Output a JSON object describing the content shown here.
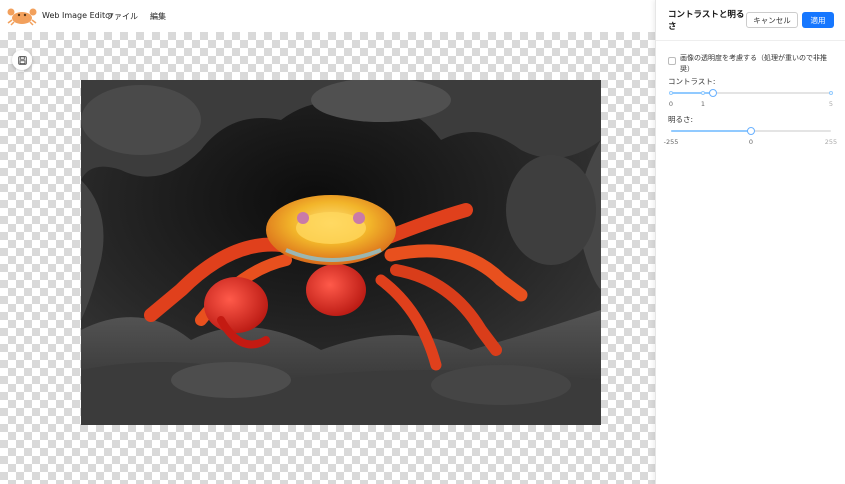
{
  "header": {
    "app_title": "Web Image Editor",
    "menu": {
      "file": "ファイル",
      "edit": "編集"
    }
  },
  "canvas": {
    "save_icon": "save-icon"
  },
  "panel": {
    "title": "コントラストと明るさ",
    "cancel_label": "キャンセル",
    "apply_label": "適用",
    "checkbox_label": "画像の透明度を考慮する（処理が重いので非推奨）",
    "checkbox_checked": false,
    "contrast": {
      "label": "コントラスト:",
      "min": 0,
      "max": 5,
      "value": 1.3,
      "marks": [
        "0",
        "1",
        "5"
      ]
    },
    "brightness": {
      "label": "明るさ:",
      "min": -255,
      "max": 255,
      "value": 0,
      "marks": [
        "-255",
        "0",
        "255"
      ]
    }
  },
  "colors": {
    "accent": "#1677ff",
    "slider_fill": "#91caff",
    "logo": "#f2a05c"
  }
}
